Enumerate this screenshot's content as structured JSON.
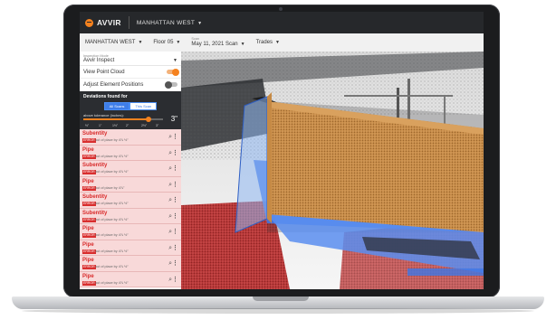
{
  "app": {
    "logo_text": "AVVIR",
    "project": "MANHATTAN WEST"
  },
  "filters": {
    "building": "MANHATTAN WEST",
    "floor": "Floor 05",
    "scan_label": "Scan",
    "scan": "May 11, 2021 Scan",
    "trades": "Trades"
  },
  "sidebar": {
    "inspection_label": "Inspection Mode",
    "inspection_value": "Avvir Inspect",
    "view_point_cloud": "View Point Cloud",
    "adjust_positions": "Adjust Element Positions",
    "deviations_title": "Deviations found for",
    "all_scans": "All Scans",
    "this_scan": "This Scan",
    "tolerance_label": "above tolerance (inches):",
    "tolerance_value": "3\"",
    "ticks": [
      "½\"",
      "1\"",
      "1½\"",
      "2\"",
      "2½\"",
      "3\""
    ],
    "items": [
      {
        "title": "Subentity",
        "badge": "ERROR",
        "sub": "out of place by 4⅞ ½\""
      },
      {
        "title": "Pipe",
        "badge": "ERROR",
        "sub": "out of place by 4⅞ ½\""
      },
      {
        "title": "Subentity",
        "badge": "ERROR",
        "sub": "out of place by 4⅞ ½\""
      },
      {
        "title": "Pipe",
        "badge": "ERROR",
        "sub": "out of place by 4⅞\""
      },
      {
        "title": "Subentity",
        "badge": "ERROR",
        "sub": "out of place by 4⅞ ½\""
      },
      {
        "title": "Subentity",
        "badge": "ERROR",
        "sub": "out of place by 4⅞ ½\""
      },
      {
        "title": "Pipe",
        "badge": "ERROR",
        "sub": "out of place by 4⅞ ½\""
      },
      {
        "title": "Pipe",
        "badge": "ERROR",
        "sub": "out of place by 4⅞ ½\""
      },
      {
        "title": "Pipe",
        "badge": "ERROR",
        "sub": "out of place by 4⅞ ½\""
      },
      {
        "title": "Pipe",
        "badge": "ERROR",
        "sub": "out of place by 4⅞ ½\""
      }
    ]
  },
  "colors": {
    "accent": "#f5821f",
    "error": "#d92e2e",
    "duct": "#c9863f",
    "duct_side": "#3f77e6",
    "red_cloud": "#b63434"
  }
}
